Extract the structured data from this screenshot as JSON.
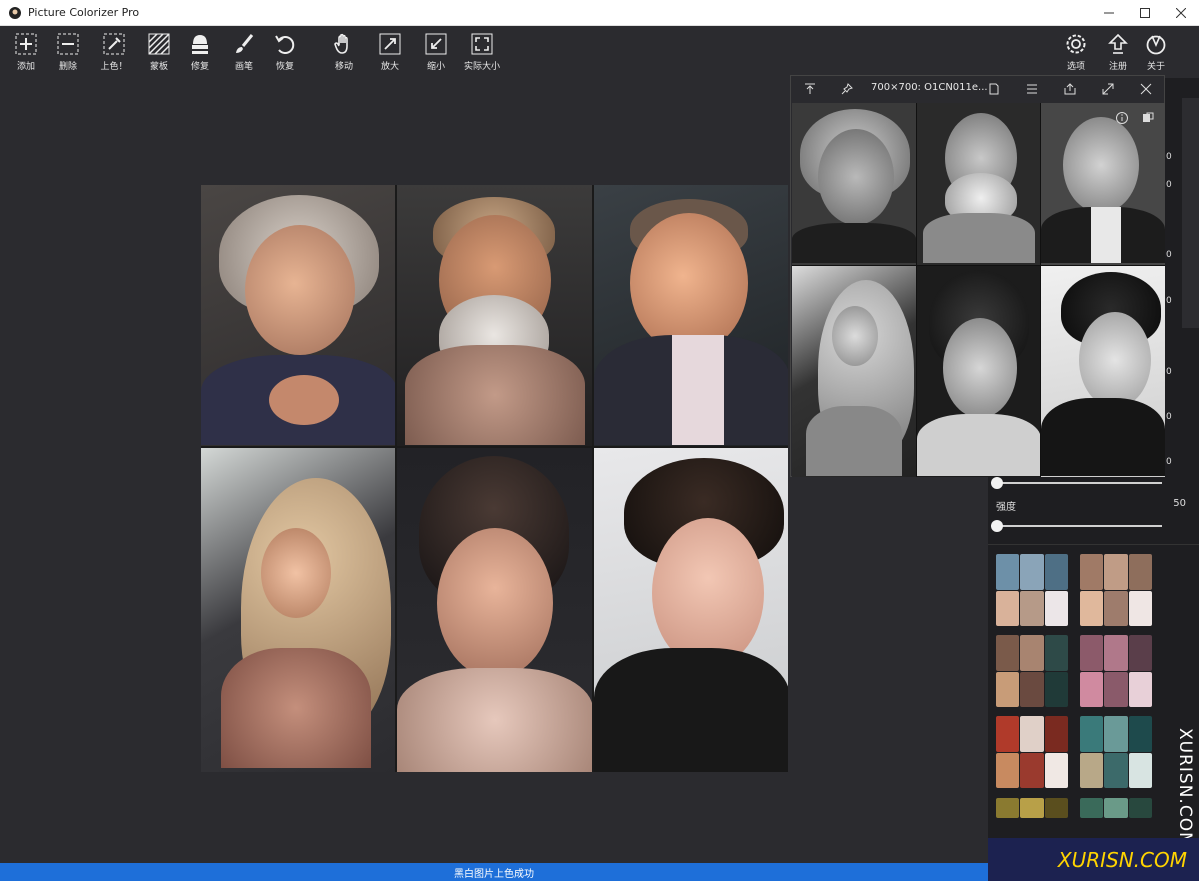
{
  "window": {
    "title": "Picture Colorizer Pro",
    "controls": [
      "minimize",
      "maximize",
      "close"
    ]
  },
  "toolbar": {
    "left_tools": [
      {
        "label": "添加",
        "icon": "plus-box-icon"
      },
      {
        "label": "删除",
        "icon": "minus-box-icon"
      },
      {
        "label": "上色！",
        "icon": "eyedropper-icon"
      },
      {
        "label": "蒙板",
        "icon": "mask-icon"
      },
      {
        "label": "修复",
        "icon": "repair-icon"
      },
      {
        "label": "画笔",
        "icon": "brush-icon"
      },
      {
        "label": "恢复",
        "icon": "undo-icon"
      },
      {
        "label": "移动",
        "icon": "hand-icon"
      },
      {
        "label": "放大",
        "icon": "zoom-in-icon"
      },
      {
        "label": "缩小",
        "icon": "zoom-out-icon"
      },
      {
        "label": "实际大小",
        "icon": "actual-size-icon"
      }
    ],
    "right_tools": [
      {
        "label": "选项",
        "icon": "gear-icon"
      },
      {
        "label": "注册",
        "icon": "upload-icon"
      },
      {
        "label": "关于",
        "icon": "compass-icon"
      }
    ]
  },
  "preview": {
    "title": "700×700: O1CN011e...",
    "buttons": [
      "pin-top-icon",
      "pin-icon",
      "file-icon",
      "list-icon",
      "share-icon",
      "expand-icon",
      "close-icon"
    ]
  },
  "panel": {
    "strength_label": "强度",
    "strength_value": "50",
    "strength_level": 0.0,
    "partial_values": [
      "0",
      "0",
      "0",
      "0",
      "0",
      "0",
      "0",
      "0",
      "0"
    ]
  },
  "watermark": "XURISN.COM",
  "corner_mark": "XURISN.COM",
  "status": "黑白图片上色成功",
  "colors": {
    "background": "#2b2b2f",
    "panel": "#1e1e21",
    "status_bar": "#1e6fd9",
    "titlebar": "#ffffff"
  }
}
